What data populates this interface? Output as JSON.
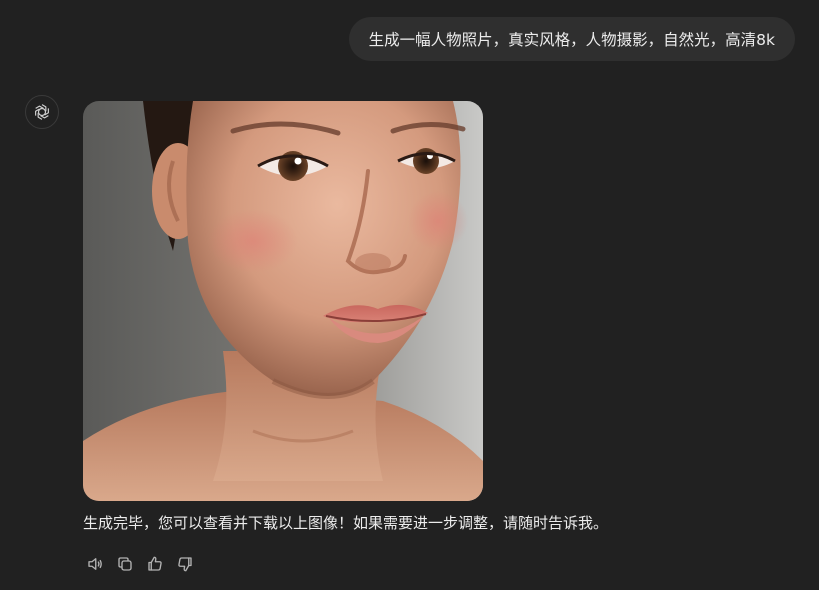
{
  "conversation": {
    "user_message": "生成一幅人物照片，真实风格，人物摄影，自然光，高清8k",
    "assistant": {
      "avatar_icon": "openai-logo-icon",
      "image_icon": "generated-portrait-image",
      "response_text": "生成完毕，您可以查看并下载以上图像！如果需要进一步调整，请随时告诉我。",
      "actions": [
        {
          "name": "read-aloud",
          "icon": "speaker-icon"
        },
        {
          "name": "copy",
          "icon": "copy-icon"
        },
        {
          "name": "good-response",
          "icon": "thumbs-up-icon"
        },
        {
          "name": "bad-response",
          "icon": "thumbs-down-icon"
        }
      ]
    }
  },
  "colors": {
    "background": "#212121",
    "user_bubble": "#2f2f2f",
    "text": "#ececec",
    "icon": "#b4b4b4"
  }
}
